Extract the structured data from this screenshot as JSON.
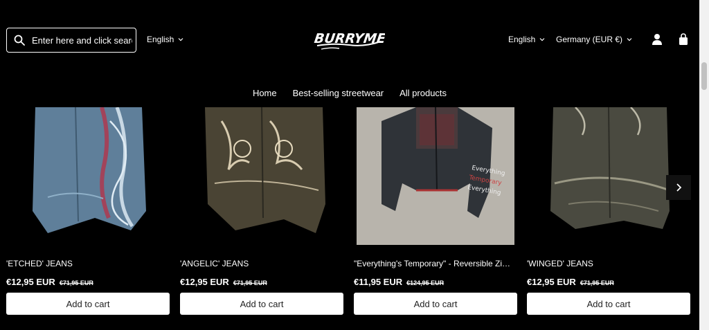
{
  "header": {
    "search_placeholder": "Enter here and click search",
    "language_left": "English",
    "logo_text": "BURRYME",
    "language_right": "English",
    "region": "Germany (EUR €)"
  },
  "nav": {
    "items": [
      "Home",
      "Best-selling streetwear",
      "All products"
    ]
  },
  "products": [
    {
      "title": "'ETCHED' JEANS",
      "price": "€12,95 EUR",
      "old_price": "€71,95 EUR",
      "button": "Add to cart"
    },
    {
      "title": "'ANGELIC' JEANS",
      "price": "€12,95 EUR",
      "old_price": "€71,95 EUR",
      "button": "Add to cart"
    },
    {
      "title": "\"Everything's Temporary\" - Reversible Zip-Up Hoodie",
      "price": "€11,95 EUR",
      "old_price": "€124,95 EUR",
      "button": "Add to cart"
    },
    {
      "title": "'WINGED' JEANS",
      "price": "€12,95 EUR",
      "old_price": "€71,95 EUR",
      "button": "Add to cart"
    }
  ],
  "icons": {
    "search": "search-icon",
    "account": "account-icon",
    "cart": "shopping-bag-icon",
    "next": "chevron-right-icon"
  }
}
